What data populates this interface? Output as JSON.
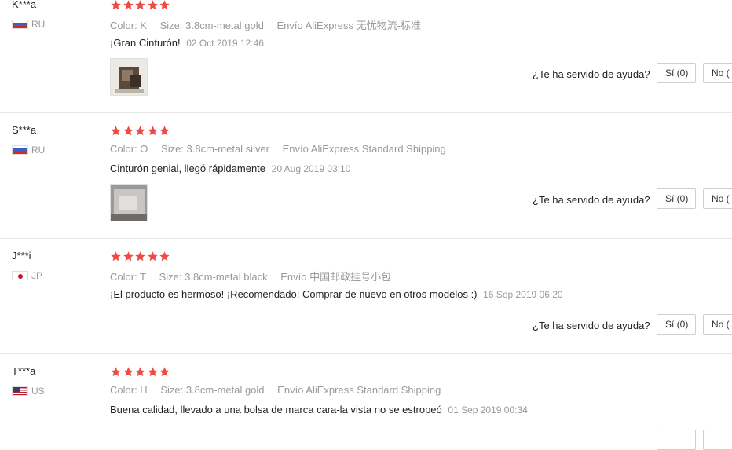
{
  "helpful_prompt": "¿Te ha servido de ayuda?",
  "reviews": [
    {
      "user": "K***a",
      "country": "RU",
      "rating": 5,
      "color": "Color: K",
      "size": "Size: 3.8cm-metal gold",
      "shipping": "Envío AliExpress 无忧物流-标准",
      "text": "¡Gran Cinturón!",
      "date": "02 Oct 2019 12:46",
      "has_photo": true,
      "yes_label": "Sí (0)",
      "no_label": "No ("
    },
    {
      "user": "S***a",
      "country": "RU",
      "rating": 5,
      "color": "Color: O",
      "size": "Size: 3.8cm-metal silver",
      "shipping": "Envío AliExpress Standard Shipping",
      "text": "Cinturón genial, llegó rápidamente",
      "date": "20 Aug 2019 03:10",
      "has_photo": true,
      "yes_label": "Sí (0)",
      "no_label": "No ("
    },
    {
      "user": "J***i",
      "country": "JP",
      "rating": 5,
      "color": "Color: T",
      "size": "Size: 3.8cm-metal black",
      "shipping": "Envío 中国邮政挂号小包",
      "text": "¡El producto es hermoso! ¡Recomendado! Comprar de nuevo en otros modelos :)",
      "date": "16 Sep 2019 06:20",
      "has_photo": false,
      "yes_label": "Sí (0)",
      "no_label": "No ("
    },
    {
      "user": "T***a",
      "country": "US",
      "rating": 5,
      "color": "Color: H",
      "size": "Size: 3.8cm-metal gold",
      "shipping": "Envío AliExpress Standard Shipping",
      "text": "Buena calidad, llevado a una bolsa de marca cara-la vista no se estropeó",
      "date": "01 Sep 2019 00:34",
      "has_photo": false,
      "yes_label": "",
      "no_label": ""
    }
  ],
  "colors": {
    "star": "#f04a45",
    "meta_text": "#999999",
    "separator": "#e8e8e8"
  },
  "icons": {
    "star": "star-icon",
    "flag_ru": "flag-ru-icon",
    "flag_jp": "flag-jp-icon",
    "flag_us": "flag-us-icon"
  }
}
